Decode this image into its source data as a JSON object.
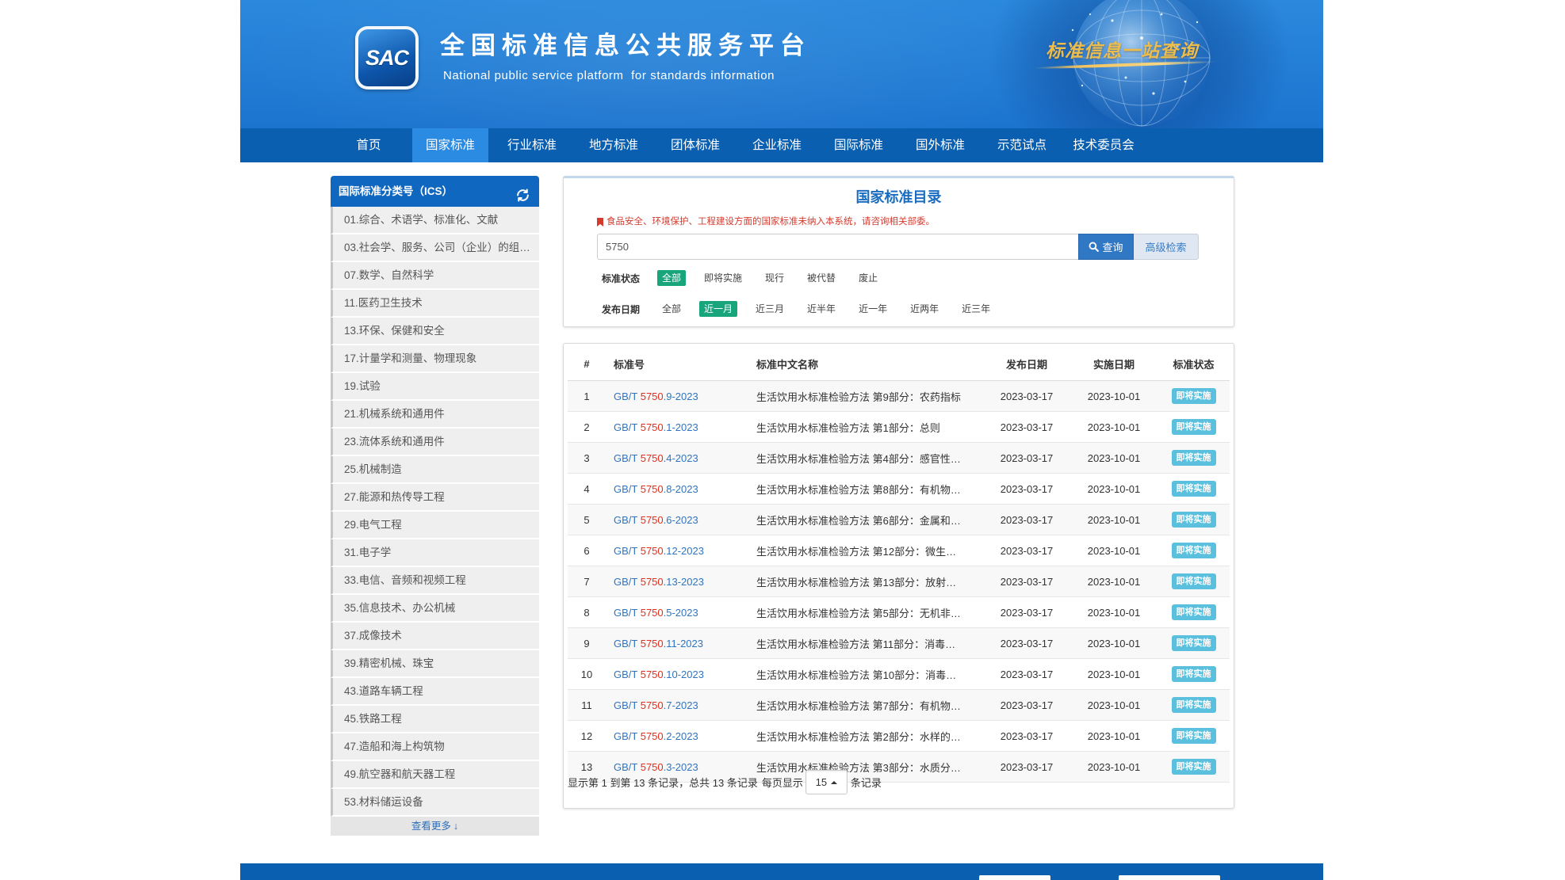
{
  "header": {
    "logo_text": "SAC",
    "title": "全国标准信息公共服务平台",
    "subtitle": "National public service platform  for standards information",
    "slogan": "标准信息一站查询"
  },
  "nav": {
    "items": [
      {
        "label": "首页",
        "active": false
      },
      {
        "label": "国家标准",
        "active": true
      },
      {
        "label": "行业标准",
        "active": false
      },
      {
        "label": "地方标准",
        "active": false
      },
      {
        "label": "团体标准",
        "active": false
      },
      {
        "label": "企业标准",
        "active": false
      },
      {
        "label": "国际标准",
        "active": false
      },
      {
        "label": "国外标准",
        "active": false
      },
      {
        "label": "示范试点",
        "active": false
      },
      {
        "label": "技术委员会",
        "active": false
      }
    ]
  },
  "sidebar": {
    "title": "国际标准分类号（ICS）",
    "refresh_icon": "refresh-icon",
    "items": [
      "01.综合、术语学、标准化、文献",
      "03.社会学、服务、公司（企业）的组…",
      "07.数学、自然科学",
      "11.医药卫生技术",
      "13.环保、保健和安全",
      "17.计量学和测量、物理现象",
      "19.试验",
      "21.机械系统和通用件",
      "23.流体系统和通用件",
      "25.机械制造",
      "27.能源和热传导工程",
      "29.电气工程",
      "31.电子学",
      "33.电信、音频和视频工程",
      "35.信息技术、办公机械",
      "37.成像技术",
      "39.精密机械、珠宝",
      "43.道路车辆工程",
      "45.铁路工程",
      "47.造船和海上构筑物",
      "49.航空器和航天器工程",
      "53.材料储运设备"
    ],
    "more_label": "查看更多",
    "more_icon": "arrow-down-icon"
  },
  "search": {
    "title": "国家标准目录",
    "notice_icon": "bookmark-icon",
    "notice": "食品安全、环境保护、工程建设方面的国家标准未纳入本系统，请咨询相关部委。",
    "query": "5750",
    "search_icon": "search-icon",
    "search_button": "查询",
    "advanced_button": "高级检索",
    "filters": [
      {
        "label": "标准状态",
        "options": [
          {
            "label": "全部",
            "selected": true
          },
          {
            "label": "即将实施",
            "selected": false
          },
          {
            "label": "现行",
            "selected": false
          },
          {
            "label": "被代替",
            "selected": false
          },
          {
            "label": "废止",
            "selected": false
          }
        ]
      },
      {
        "label": "发布日期",
        "options": [
          {
            "label": "全部",
            "selected": false
          },
          {
            "label": "近一月",
            "selected": true
          },
          {
            "label": "近三月",
            "selected": false
          },
          {
            "label": "近半年",
            "selected": false
          },
          {
            "label": "近一年",
            "selected": false
          },
          {
            "label": "近两年",
            "selected": false
          },
          {
            "label": "近三年",
            "selected": false
          }
        ]
      }
    ]
  },
  "table": {
    "columns": [
      "#",
      "标准号",
      "标准中文名称",
      "发布日期",
      "实施日期",
      "标准状态"
    ],
    "rows": [
      {
        "no": "1",
        "std_prefix": "GB/T ",
        "std_highlight": "5750",
        "std_suffix": ".9-2023",
        "name": "生活饮用水标准检验方法 第9部分：农药指标",
        "publish_date": "2023-03-17",
        "implement_date": "2023-10-01",
        "status": "即将实施"
      },
      {
        "no": "2",
        "std_prefix": "GB/T ",
        "std_highlight": "5750",
        "std_suffix": ".1-2023",
        "name": "生活饮用水标准检验方法 第1部分：总则",
        "publish_date": "2023-03-17",
        "implement_date": "2023-10-01",
        "status": "即将实施"
      },
      {
        "no": "3",
        "std_prefix": "GB/T ",
        "std_highlight": "5750",
        "std_suffix": ".4-2023",
        "name": "生活饮用水标准检验方法 第4部分：感官性…",
        "publish_date": "2023-03-17",
        "implement_date": "2023-10-01",
        "status": "即将实施"
      },
      {
        "no": "4",
        "std_prefix": "GB/T ",
        "std_highlight": "5750",
        "std_suffix": ".8-2023",
        "name": "生活饮用水标准检验方法 第8部分：有机物…",
        "publish_date": "2023-03-17",
        "implement_date": "2023-10-01",
        "status": "即将实施"
      },
      {
        "no": "5",
        "std_prefix": "GB/T ",
        "std_highlight": "5750",
        "std_suffix": ".6-2023",
        "name": "生活饮用水标准检验方法 第6部分：金属和…",
        "publish_date": "2023-03-17",
        "implement_date": "2023-10-01",
        "status": "即将实施"
      },
      {
        "no": "6",
        "std_prefix": "GB/T ",
        "std_highlight": "5750",
        "std_suffix": ".12-2023",
        "name": "生活饮用水标准检验方法 第12部分：微生…",
        "publish_date": "2023-03-17",
        "implement_date": "2023-10-01",
        "status": "即将实施"
      },
      {
        "no": "7",
        "std_prefix": "GB/T ",
        "std_highlight": "5750",
        "std_suffix": ".13-2023",
        "name": "生活饮用水标准检验方法 第13部分：放射…",
        "publish_date": "2023-03-17",
        "implement_date": "2023-10-01",
        "status": "即将实施"
      },
      {
        "no": "8",
        "std_prefix": "GB/T ",
        "std_highlight": "5750",
        "std_suffix": ".5-2023",
        "name": "生活饮用水标准检验方法 第5部分：无机非…",
        "publish_date": "2023-03-17",
        "implement_date": "2023-10-01",
        "status": "即将实施"
      },
      {
        "no": "9",
        "std_prefix": "GB/T ",
        "std_highlight": "5750",
        "std_suffix": ".11-2023",
        "name": "生活饮用水标准检验方法 第11部分：消毒…",
        "publish_date": "2023-03-17",
        "implement_date": "2023-10-01",
        "status": "即将实施"
      },
      {
        "no": "10",
        "std_prefix": "GB/T ",
        "std_highlight": "5750",
        "std_suffix": ".10-2023",
        "name": "生活饮用水标准检验方法 第10部分：消毒…",
        "publish_date": "2023-03-17",
        "implement_date": "2023-10-01",
        "status": "即将实施"
      },
      {
        "no": "11",
        "std_prefix": "GB/T ",
        "std_highlight": "5750",
        "std_suffix": ".7-2023",
        "name": "生活饮用水标准检验方法 第7部分：有机物…",
        "publish_date": "2023-03-17",
        "implement_date": "2023-10-01",
        "status": "即将实施"
      },
      {
        "no": "12",
        "std_prefix": "GB/T ",
        "std_highlight": "5750",
        "std_suffix": ".2-2023",
        "name": "生活饮用水标准检验方法 第2部分：水样的…",
        "publish_date": "2023-03-17",
        "implement_date": "2023-10-01",
        "status": "即将实施"
      },
      {
        "no": "13",
        "std_prefix": "GB/T ",
        "std_highlight": "5750",
        "std_suffix": ".3-2023",
        "name": "生活饮用水标准检验方法 第3部分：水质分…",
        "publish_date": "2023-03-17",
        "implement_date": "2023-10-01",
        "status": "即将实施"
      }
    ]
  },
  "pagination": {
    "summary": "显示第 1 到第 13 条记录，总共 13 条记录",
    "per_page_label": "每页显示",
    "per_page_value": "15",
    "per_page_icon": "caret-up-icon",
    "per_page_suffix": "条记录"
  },
  "colors": {
    "nav_bg": "#0b5fb0",
    "nav_active": "#2b8ae2",
    "filter_active": "#19a57c",
    "badge": "#5bc0de",
    "link": "#2f74c0",
    "highlight": "#e02f1f",
    "notice": "#d43a2e",
    "sidebar_header": "#1067c0",
    "search_button": "#3078c4",
    "slogan": "#ecbc4c"
  }
}
